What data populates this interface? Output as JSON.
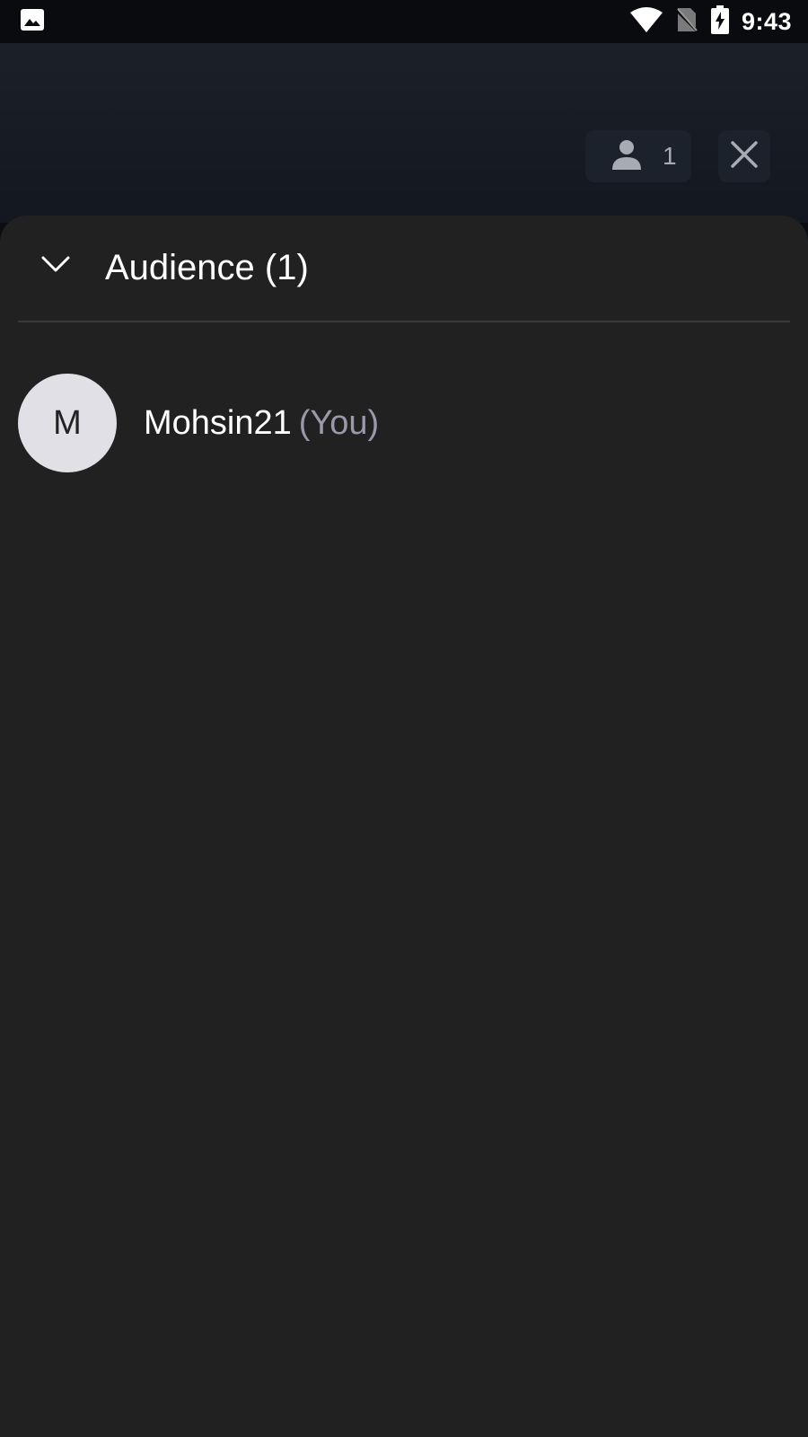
{
  "status_bar": {
    "time": "9:43",
    "icons": [
      "image-notification-icon",
      "wifi-icon",
      "no-sim-icon",
      "battery-charging-icon"
    ]
  },
  "top_bar": {
    "viewer_count": "1",
    "icons": [
      "person-icon",
      "close-icon"
    ]
  },
  "sheet": {
    "title": "Audience (1)",
    "collapse_icon": "chevron-down-icon"
  },
  "participants": [
    {
      "initial": "M",
      "name": "Mohsin21",
      "tag": "(You)"
    }
  ],
  "colors": {
    "sheet_background": "#212121",
    "top_background": "#1b2029",
    "avatar_background": "#e0e0e6",
    "secondary_text": "#9b98a8"
  }
}
